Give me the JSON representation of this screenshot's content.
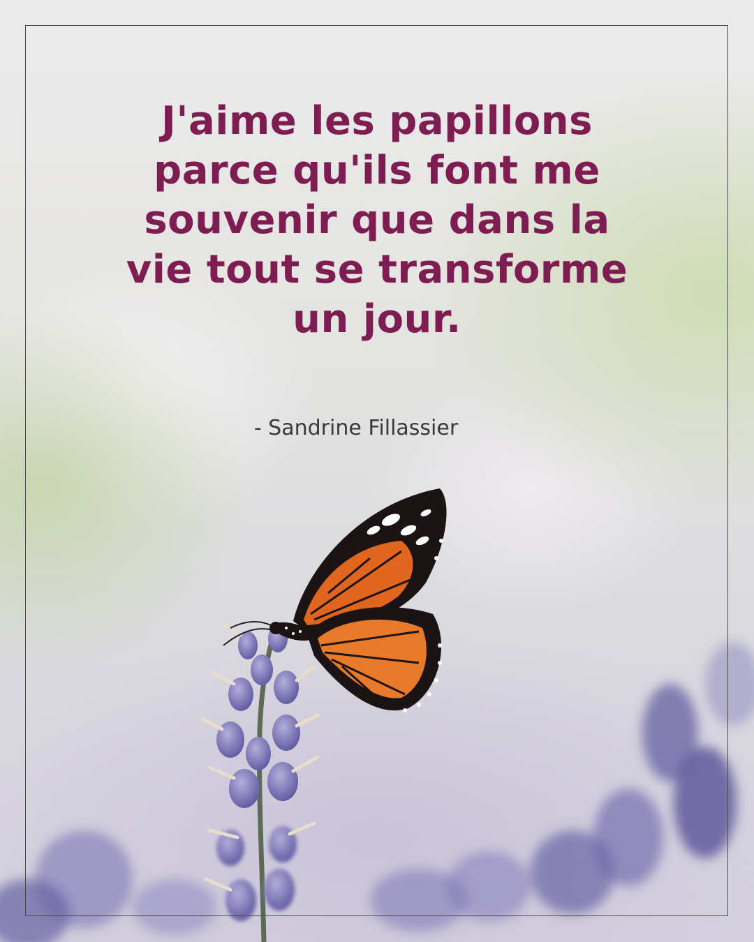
{
  "quote": {
    "lines": [
      "J'aime les papillons",
      "parce qu'ils font me",
      "souvenir que dans la",
      "vie tout se transforme",
      "un jour."
    ],
    "author": "- Sandrine Fillassier"
  },
  "colors": {
    "quote_text": "#7d1d52",
    "author_text": "#3a3a3a",
    "frame_border": "#4a4a4a",
    "butterfly_orange": "#e0651e",
    "lavender": "#7f77b4"
  },
  "icons": {
    "butterfly": "monarch-butterfly",
    "flower": "lavender-sprig"
  }
}
